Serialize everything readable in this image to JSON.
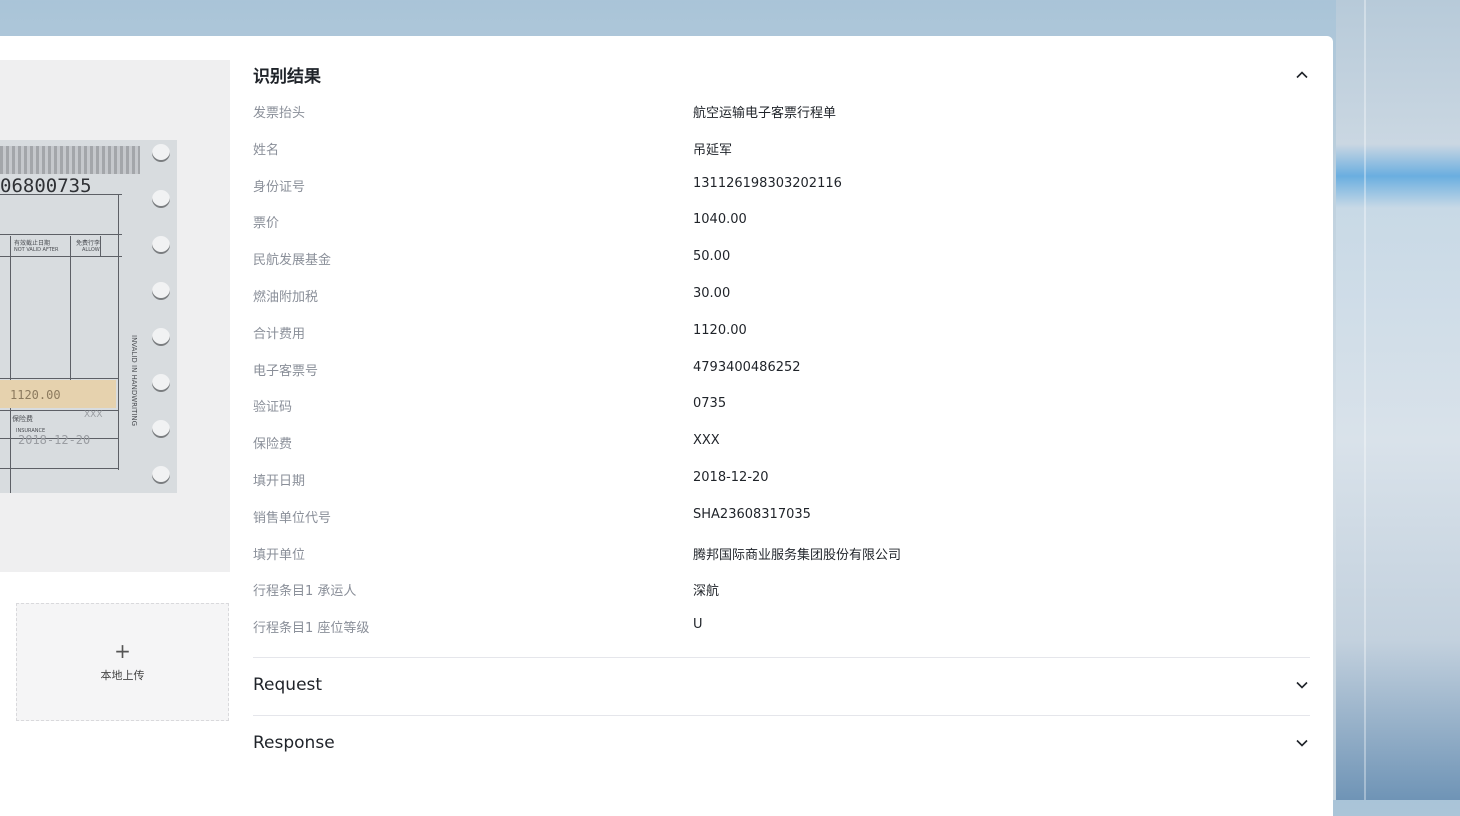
{
  "upload": {
    "label": "本地上传",
    "plus": "+"
  },
  "ticket_preview": {
    "number": "06800735",
    "fee": "1120.00",
    "header_valid": "有效截止日期",
    "header_valid_en": "NOT VALID AFTER",
    "header_allow": "免费行李",
    "header_allow_en": "ALLOW",
    "insurance": "保险费",
    "insurance_en": "INSURANCE",
    "date": "2018-12-20",
    "insurance_value": "XXX",
    "side": "INVALID IN HANDWRITING"
  },
  "results": {
    "title": "识别结果",
    "fields": [
      {
        "key": "发票抬头",
        "value": "航空运输电子客票行程单"
      },
      {
        "key": "姓名",
        "value": "吊延军"
      },
      {
        "key": "身份证号",
        "value": "131126198303202116"
      },
      {
        "key": "票价",
        "value": "1040.00"
      },
      {
        "key": "民航发展基金",
        "value": "50.00"
      },
      {
        "key": "燃油附加税",
        "value": "30.00"
      },
      {
        "key": "合计费用",
        "value": "1120.00"
      },
      {
        "key": "电子客票号",
        "value": "4793400486252"
      },
      {
        "key": "验证码",
        "value": "0735"
      },
      {
        "key": "保险费",
        "value": "XXX"
      },
      {
        "key": "填开日期",
        "value": "2018-12-20"
      },
      {
        "key": "销售单位代号",
        "value": "SHA23608317035"
      },
      {
        "key": "填开单位",
        "value": "腾邦国际商业服务集团股份有限公司"
      },
      {
        "key": "行程条目1 承运人",
        "value": "深航"
      },
      {
        "key": "行程条目1 座位等级",
        "value": "U"
      }
    ]
  },
  "request": {
    "title": "Request"
  },
  "response": {
    "title": "Response"
  },
  "icons": {
    "collapse": "chevron-up-icon",
    "expand": "chevron-down-icon"
  }
}
